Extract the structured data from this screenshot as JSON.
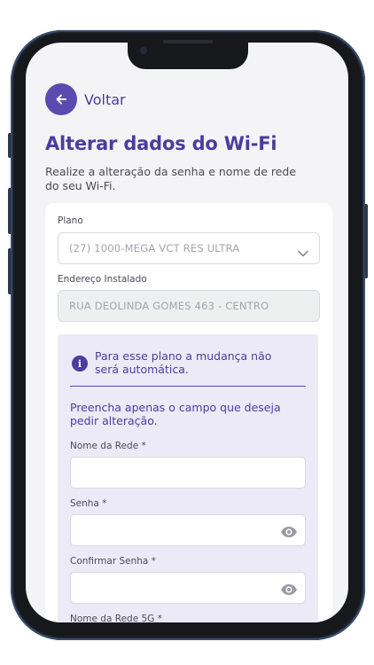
{
  "header": {
    "back_label": "Voltar",
    "title": "Alterar dados do Wi-Fi",
    "subtitle": "Realize a alteração da senha e nome de rede do seu Wi-Fi."
  },
  "form": {
    "plano": {
      "label": "Plano",
      "value": "(27) 1000-MEGA VCT RES ULTRA"
    },
    "endereco": {
      "label": "Endereço Instalado",
      "value": "RUA DEOLINDA GOMES 463 - CENTRO"
    },
    "notice": "Para esse plano a mudança não será automática.",
    "instruction": "Preencha apenas o campo que deseja pedir alteração.",
    "nome_rede": {
      "label": "Nome da Rede *",
      "value": ""
    },
    "senha": {
      "label": "Senha *",
      "value": ""
    },
    "confirmar_senha": {
      "label": "Confirmar Senha *",
      "value": ""
    },
    "nome_rede_5g": {
      "label": "Nome da Rede 5G *"
    }
  },
  "colors": {
    "primary": "#4b3c9e",
    "panel_bg": "#edeaf7",
    "screen_bg": "#f4f4f6"
  },
  "icons": [
    "arrow-left-icon",
    "chevron-down-icon",
    "info-icon",
    "eye-icon"
  ]
}
